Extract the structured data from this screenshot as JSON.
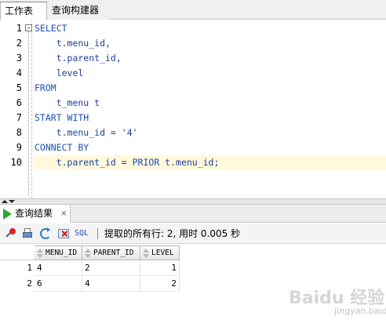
{
  "tabs": {
    "worksheet": "工作表",
    "query_builder": "查询构建器"
  },
  "editor": {
    "line_numbers": [
      "1",
      "2",
      "3",
      "4",
      "5",
      "6",
      "7",
      "8",
      "9",
      "10"
    ],
    "lines": [
      {
        "tokens": [
          {
            "t": "kw",
            "v": "SELECT"
          }
        ]
      },
      {
        "tokens": [
          {
            "t": "id",
            "v": "    t.menu_id,"
          }
        ]
      },
      {
        "tokens": [
          {
            "t": "id",
            "v": "    t.parent_id,"
          }
        ]
      },
      {
        "tokens": [
          {
            "t": "id",
            "v": "    level"
          }
        ]
      },
      {
        "tokens": [
          {
            "t": "kw",
            "v": "FROM"
          }
        ]
      },
      {
        "tokens": [
          {
            "t": "id",
            "v": "    t_menu t"
          }
        ]
      },
      {
        "tokens": [
          {
            "t": "kw",
            "v": "START WITH"
          }
        ]
      },
      {
        "tokens": [
          {
            "t": "id",
            "v": "    t.menu_id = "
          },
          {
            "t": "str",
            "v": "'4'"
          }
        ]
      },
      {
        "tokens": [
          {
            "t": "kw",
            "v": "CONNECT BY"
          }
        ]
      },
      {
        "tokens": [
          {
            "t": "id",
            "v": "    t.parent_id = "
          },
          {
            "t": "kw",
            "v": "PRIOR"
          },
          {
            "t": "id",
            "v": " t.menu_id;"
          }
        ]
      }
    ],
    "current_line": 10
  },
  "results": {
    "tab_label": "查询结果",
    "close_symbol": "×",
    "toolbar": {
      "sql_label": "SQL",
      "status": "提取的所有行: 2, 用时 0.005 秒"
    },
    "columns": [
      "MENU_ID",
      "PARENT_ID",
      "LEVEL"
    ],
    "rows": [
      {
        "num": "1",
        "cells": [
          "4",
          "2",
          "1"
        ]
      },
      {
        "num": "2",
        "cells": [
          "6",
          "4",
          "2"
        ]
      }
    ]
  },
  "colors": {
    "keyword": "#1e50b4",
    "current_line_bg": "#fff8dc",
    "run_icon": "#2fa52f"
  },
  "watermark": {
    "text": "Baidu 经验",
    "sub": "jingyan.baidu.com"
  }
}
